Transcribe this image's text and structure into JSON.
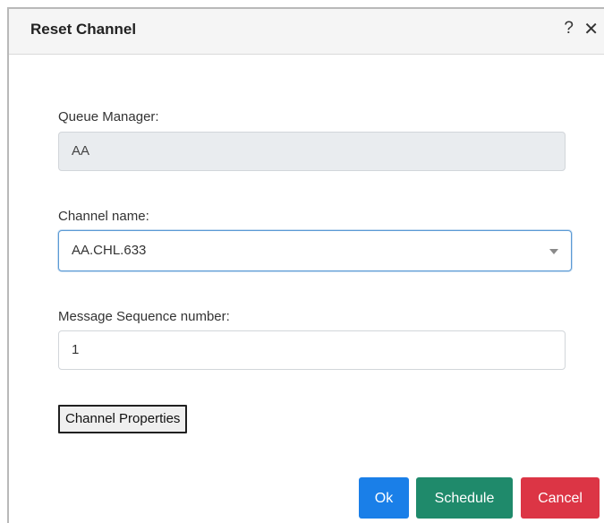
{
  "dialog": {
    "title": "Reset Channel",
    "help_glyph": "?",
    "close_glyph": "✕",
    "icons": [
      "help-icon",
      "close-icon",
      "chevron-down-icon"
    ]
  },
  "form": {
    "queue_manager": {
      "label": "Queue Manager:",
      "value": "AA"
    },
    "channel_name": {
      "label": "Channel name:",
      "value": "AA.CHL.633"
    },
    "sequence_number": {
      "label": "Message Sequence number:",
      "value": "1"
    },
    "channel_properties_label": "Channel Properties"
  },
  "actions": {
    "ok_label": "Ok",
    "schedule_label": "Schedule",
    "cancel_label": "Cancel"
  },
  "colors": {
    "ok": "#1a7fe8",
    "schedule": "#1f8a6b",
    "cancel": "#dc3545",
    "focus_border": "#5b9ad5"
  }
}
